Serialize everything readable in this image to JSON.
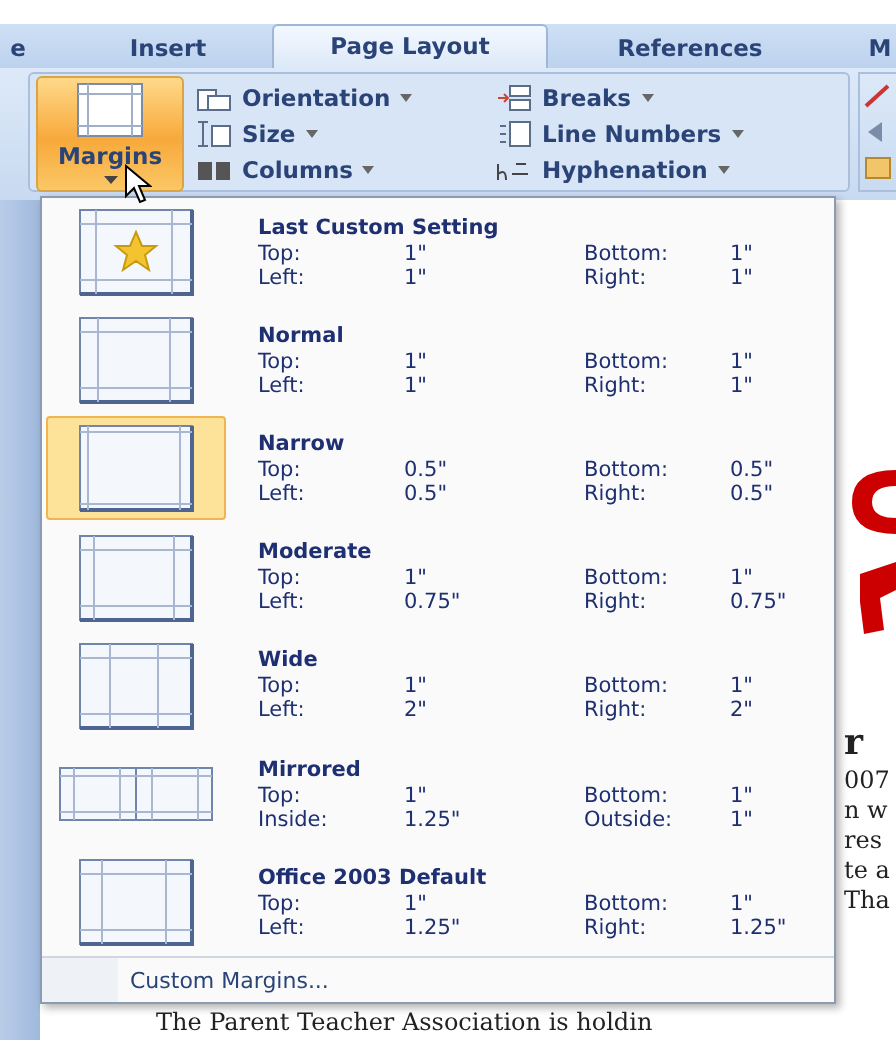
{
  "tabs": [
    {
      "label": "e",
      "selected": false
    },
    {
      "label": "Insert",
      "selected": false
    },
    {
      "label": "Page Layout",
      "selected": true
    },
    {
      "label": "References",
      "selected": false
    },
    {
      "label": "M",
      "selected": false
    }
  ],
  "ribbon": {
    "margins": {
      "label": "Margins",
      "highlighted": true
    },
    "columns": [
      [
        {
          "label": "Orientation"
        },
        {
          "label": "Size"
        },
        {
          "label": "Columns"
        }
      ],
      [
        {
          "label": "Breaks"
        },
        {
          "label": "Line Numbers"
        },
        {
          "label": "Hyphenation"
        }
      ]
    ]
  },
  "margins_menu": {
    "items": [
      {
        "kind": "custom",
        "title": "Last Custom Setting",
        "selected": false,
        "rows": [
          [
            "Top:",
            "1\"",
            "Bottom:",
            "1\""
          ],
          [
            "Left:",
            "1\"",
            "Right:",
            "1\""
          ]
        ]
      },
      {
        "kind": "normal",
        "title": "Normal",
        "selected": false,
        "rows": [
          [
            "Top:",
            "1\"",
            "Bottom:",
            "1\""
          ],
          [
            "Left:",
            "1\"",
            "Right:",
            "1\""
          ]
        ]
      },
      {
        "kind": "narrow",
        "title": "Narrow",
        "selected": true,
        "rows": [
          [
            "Top:",
            "0.5\"",
            "Bottom:",
            "0.5\""
          ],
          [
            "Left:",
            "0.5\"",
            "Right:",
            "0.5\""
          ]
        ]
      },
      {
        "kind": "moderate",
        "title": "Moderate",
        "selected": false,
        "rows": [
          [
            "Top:",
            "1\"",
            "Bottom:",
            "1\""
          ],
          [
            "Left:",
            "0.75\"",
            "Right:",
            "0.75\""
          ]
        ]
      },
      {
        "kind": "wide",
        "title": "Wide",
        "selected": false,
        "rows": [
          [
            "Top:",
            "1\"",
            "Bottom:",
            "1\""
          ],
          [
            "Left:",
            "2\"",
            "Right:",
            "2\""
          ]
        ]
      },
      {
        "kind": "mirrored",
        "title": "Mirrored",
        "selected": false,
        "rows": [
          [
            "Top:",
            "1\"",
            "Bottom:",
            "1\""
          ],
          [
            "Inside:",
            "1.25\"",
            "Outside:",
            "1\""
          ]
        ]
      },
      {
        "kind": "office2003",
        "title": "Office 2003 Default",
        "selected": false,
        "rows": [
          [
            "Top:",
            "1\"",
            "Bottom:",
            "1\""
          ],
          [
            "Left:",
            "1.25\"",
            "Right:",
            "1.25\""
          ]
        ]
      }
    ],
    "footer": "Custom Margins..."
  },
  "document": {
    "side_lines": [
      "r",
      "007",
      "n w",
      "res",
      "te a",
      "Tha"
    ],
    "bottom_line": "The Parent Teacher Association is holdin"
  }
}
